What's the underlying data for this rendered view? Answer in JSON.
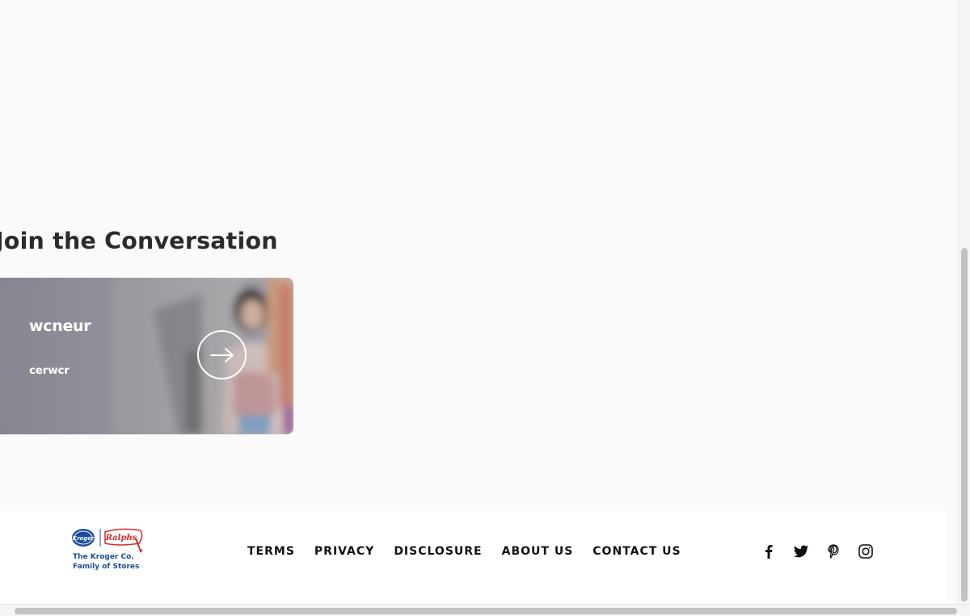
{
  "section": {
    "title": "Join the Conversation"
  },
  "card": {
    "title": "wcneur",
    "subtitle": "cerwcr",
    "arrow_icon": "arrow-right-icon"
  },
  "footer": {
    "logo": {
      "line1": "The Kroger Co.",
      "line2": "Family of Stores"
    },
    "nav": [
      {
        "label": "TERMS"
      },
      {
        "label": "PRIVACY"
      },
      {
        "label": "DISCLOSURE"
      },
      {
        "label": "ABOUT US"
      },
      {
        "label": "CONTACT US"
      }
    ],
    "social": [
      "facebook-icon",
      "twitter-icon",
      "pinterest-icon",
      "instagram-icon"
    ]
  },
  "colors": {
    "background": "#fafafa",
    "title": "#2b2b2b",
    "footer_text": "#111111",
    "logo_blue": "#1b4d9b",
    "logo_red": "#d62b2b"
  }
}
